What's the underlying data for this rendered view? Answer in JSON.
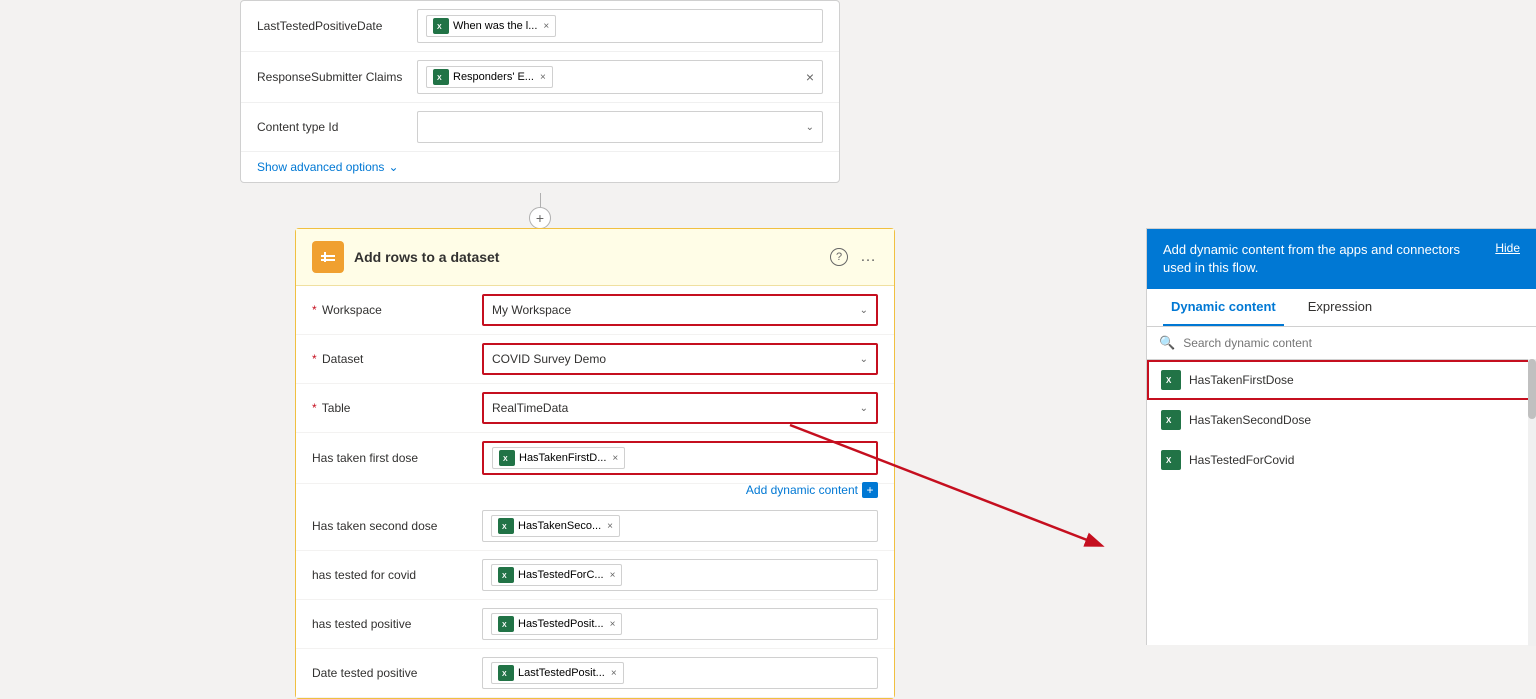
{
  "topCard": {
    "rows": [
      {
        "label": "LastTestedPositiveDate",
        "tag": "When was the l...",
        "hasClose": true
      },
      {
        "label": "ResponseSubmitter Claims",
        "tag": "Responders' E...",
        "hasClose": true,
        "hasClear": true
      },
      {
        "label": "Content type Id",
        "dropdown": true
      }
    ],
    "showAdvanced": "Show advanced options"
  },
  "connector": {
    "plusSymbol": "+"
  },
  "mainCard": {
    "title": "Add rows to a dataset",
    "helpTooltip": "?",
    "ellipsis": "...",
    "fields": [
      {
        "id": "workspace",
        "label": "Workspace",
        "required": true,
        "value": "My Workspace",
        "highlighted": true,
        "dropdown": true
      },
      {
        "id": "dataset",
        "label": "Dataset",
        "required": true,
        "value": "COVID Survey Demo",
        "highlighted": true,
        "dropdown": true
      },
      {
        "id": "table",
        "label": "Table",
        "required": true,
        "value": "RealTimeData",
        "highlighted": true,
        "dropdown": true
      },
      {
        "id": "has-taken-first-dose",
        "label": "Has taken first dose",
        "tag": "HasTakenFirstD...",
        "highlighted": true
      },
      {
        "id": "has-taken-second-dose",
        "label": "Has taken second dose",
        "tag": "HasTakenSeco..."
      },
      {
        "id": "has-tested-for-covid",
        "label": "has tested for covid",
        "tag": "HasTestedForC..."
      },
      {
        "id": "has-tested-positive",
        "label": "has tested positive",
        "tag": "HasTestedPosit..."
      },
      {
        "id": "date-tested-positive",
        "label": "Date tested positive",
        "tag": "LastTestedPosit..."
      }
    ],
    "addDynamicContent": "Add dynamic content"
  },
  "rightPanel": {
    "header": "Add dynamic content from the apps and connectors used in this flow.",
    "hideLabel": "Hide",
    "tabs": [
      "Dynamic content",
      "Expression"
    ],
    "activeTab": "Dynamic content",
    "searchPlaceholder": "Search dynamic content",
    "items": [
      {
        "label": "HasTakenFirstDose",
        "highlighted": true
      },
      {
        "label": "HasTakenSecondDose",
        "highlighted": false
      },
      {
        "label": "HasTestedForCovid",
        "highlighted": false
      }
    ]
  }
}
